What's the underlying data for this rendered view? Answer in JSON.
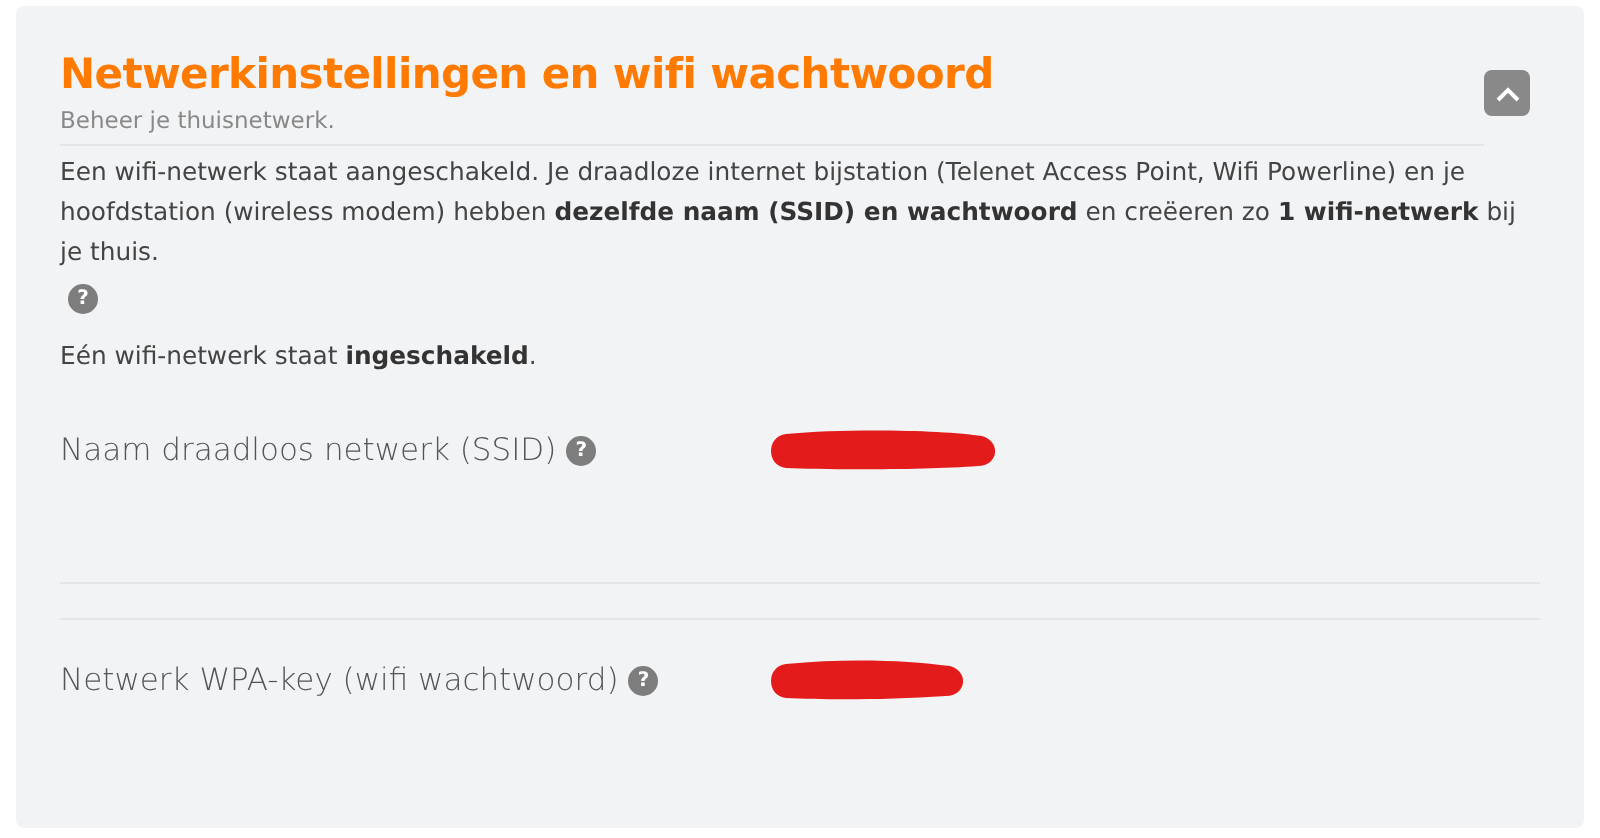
{
  "panel": {
    "title": "Netwerkinstellingen en wifi wachtwoord",
    "subtitle": "Beheer je thuisnetwerk.",
    "expanded": true,
    "description": "Een wifi-netwerk staat aangeschakeld. Je draadloze internet bijstation (Telenet Access Point, Wifi Powerline) en je hoofdstation (wireless modem) hebben **dezelfde naam (SSID) en wachtwoord** en creëeren zo **1 wifi-netwerk** bij je thuis.",
    "description_help": "?",
    "status": "Eén wifi-netwerk staat **ingeschakeld**.",
    "fields": [
      {
        "label": "Naam draadloos netwerk (SSID)",
        "help": "?",
        "redacted": true
      },
      {
        "label": "Netwerk WPA-key (wifi wachtwoord)",
        "help": "?",
        "redacted": true
      }
    ]
  }
}
